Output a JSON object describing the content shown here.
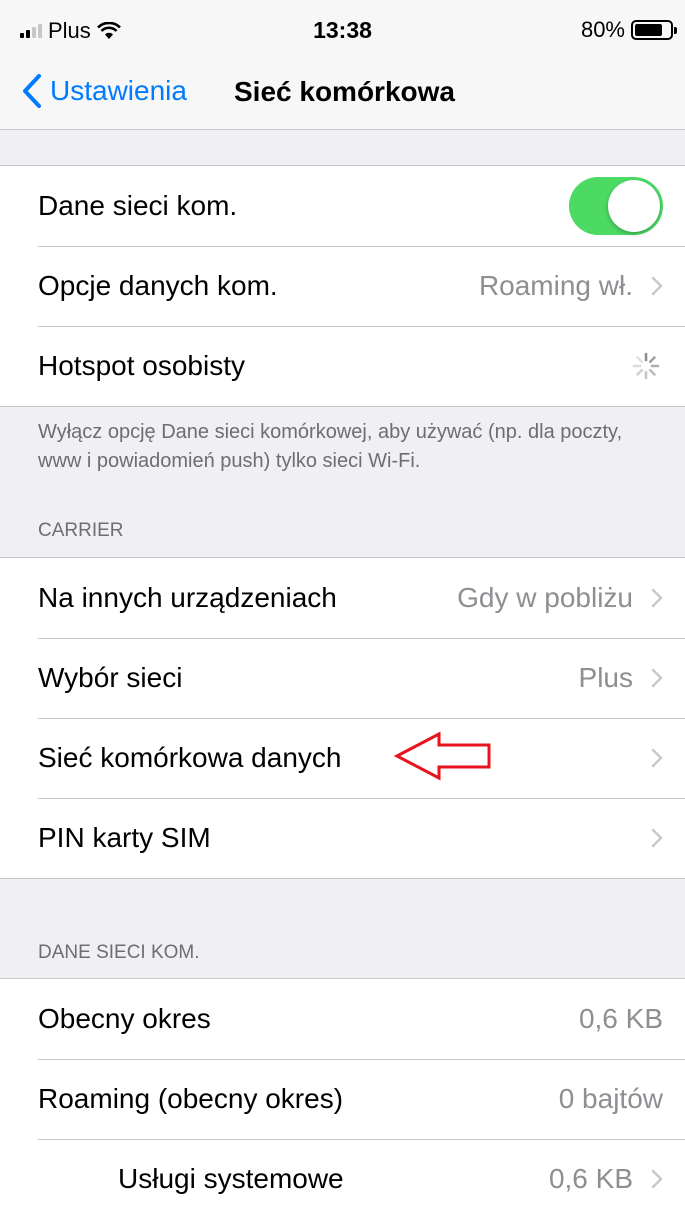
{
  "status_bar": {
    "carrier": "Plus",
    "time": "13:38",
    "battery": "80%",
    "battery_level": 0.8
  },
  "nav": {
    "back_label": "Ustawienia",
    "title": "Sieć komórkowa"
  },
  "group1": {
    "rows": [
      {
        "label": "Dane sieci kom.",
        "toggle_on": true
      },
      {
        "label": "Opcje danych kom.",
        "value": "Roaming wł."
      },
      {
        "label": "Hotspot osobisty",
        "loading": true
      }
    ],
    "footer": "Wyłącz opcję Dane sieci komórkowej, aby używać (np. dla poczty, www i powiadomień push) tylko sieci Wi-Fi."
  },
  "group2": {
    "header": "CARRIER",
    "rows": [
      {
        "label": "Na innych urządzeniach",
        "value": "Gdy w pobliżu"
      },
      {
        "label": "Wybór sieci",
        "value": "Plus"
      },
      {
        "label": "Sieć komórkowa danych",
        "value": ""
      },
      {
        "label": "PIN karty SIM",
        "value": ""
      }
    ]
  },
  "group3": {
    "header": "DANE SIECI KOM.",
    "rows": [
      {
        "label": "Obecny okres",
        "value": "0,6 KB"
      },
      {
        "label": "Roaming (obecny okres)",
        "value": "0 bajtów"
      },
      {
        "label": "Usługi systemowe",
        "value": "0,6 KB"
      }
    ]
  },
  "colors": {
    "accent": "#007aff",
    "toggle_on": "#4cd964",
    "annotation": "#e8141b"
  }
}
